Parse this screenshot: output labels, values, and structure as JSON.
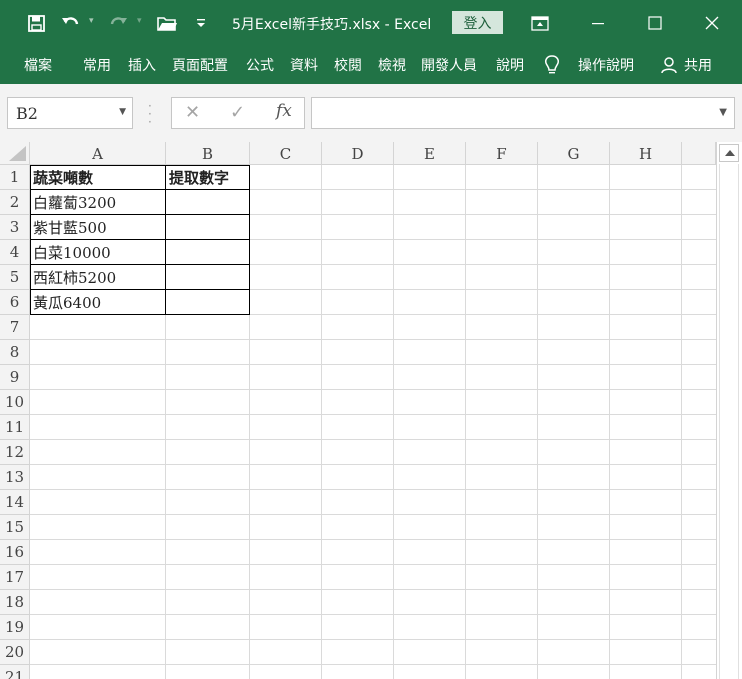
{
  "qat": {
    "save_icon": "save-icon",
    "undo_icon": "undo-icon",
    "redo_icon": "redo-icon",
    "open_icon": "folder-open-icon",
    "customize_icon": "customize-qat-icon"
  },
  "window": {
    "title": "5月Excel新手技巧.xlsx  -  Excel",
    "login_label": "登入",
    "ribbon_display_icon": "ribbon-display-options-icon",
    "minimize_icon": "minimize-icon",
    "maximize_icon": "maximize-icon",
    "close_icon": "close-icon"
  },
  "ribbon": {
    "tabs": [
      {
        "label": "檔案"
      },
      {
        "label": "常用"
      },
      {
        "label": "插入"
      },
      {
        "label": "頁面配置"
      },
      {
        "label": "公式"
      },
      {
        "label": "資料"
      },
      {
        "label": "校閱"
      },
      {
        "label": "檢視"
      },
      {
        "label": "開發人員"
      },
      {
        "label": "說明"
      }
    ],
    "tell_me": "操作說明",
    "tell_me_icon": "lightbulb-icon",
    "share": "共用",
    "share_icon": "person-icon"
  },
  "formula_bar": {
    "name_box": "B2",
    "cancel_icon": "cancel-x-icon",
    "enter_icon": "checkmark-icon",
    "fx_label": "fx",
    "formula": ""
  },
  "sheet": {
    "columns": [
      "A",
      "B",
      "C",
      "D",
      "E",
      "F",
      "G",
      "H"
    ],
    "rows": [
      "1",
      "2",
      "3",
      "4",
      "5",
      "6",
      "7",
      "8",
      "9",
      "10",
      "11",
      "12",
      "13",
      "14",
      "15",
      "16",
      "17",
      "18",
      "19",
      "20",
      "21"
    ],
    "cells": {
      "A1": "蔬菜噸數",
      "B1": "提取數字",
      "A2": "白蘿蔔3200",
      "A3": "紫甘藍500",
      "A4": "白菜10000",
      "A5": "西紅柿5200",
      "A6": "黃瓜6400"
    },
    "colors": {
      "header_bg": "#f3f3f3",
      "gridline": "#dadada",
      "accent": "#217346"
    }
  }
}
